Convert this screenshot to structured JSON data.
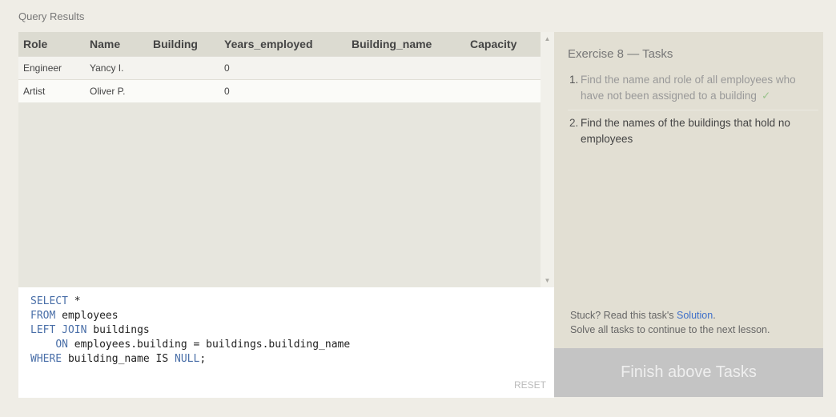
{
  "results": {
    "title": "Query Results",
    "columns": [
      "Role",
      "Name",
      "Building",
      "Years_employed",
      "Building_name",
      "Capacity"
    ],
    "rows": [
      [
        "Engineer",
        "Yancy I.",
        "",
        "0",
        "",
        ""
      ],
      [
        "Artist",
        "Oliver P.",
        "",
        "0",
        "",
        ""
      ]
    ]
  },
  "editor": {
    "line1_kw": "SELECT",
    "line1_rest": " *",
    "line2_kw": "FROM",
    "line2_rest": " employees",
    "line3_kw": "LEFT JOIN",
    "line3_rest": " buildings",
    "line4_kw": "ON",
    "line4_rest": " employees.building = buildings.building_name",
    "line5_kw": "WHERE",
    "line5_mid": " building_name IS ",
    "line5_kw2": "NULL",
    "line5_end": ";",
    "reset_label": "RESET"
  },
  "tasks": {
    "title": "Exercise 8 — Tasks",
    "items": [
      {
        "number": "1.",
        "text": "Find the name and role of all employees who have not been assigned to a building",
        "check": "✓"
      },
      {
        "number": "2.",
        "text": "Find the names of the buildings that hold no employees"
      }
    ],
    "hint_prefix": "Stuck? Read this task's ",
    "hint_link": "Solution",
    "hint_suffix": ".",
    "hint_line2": "Solve all tasks to continue to the next lesson.",
    "finish_label": "Finish above Tasks"
  }
}
